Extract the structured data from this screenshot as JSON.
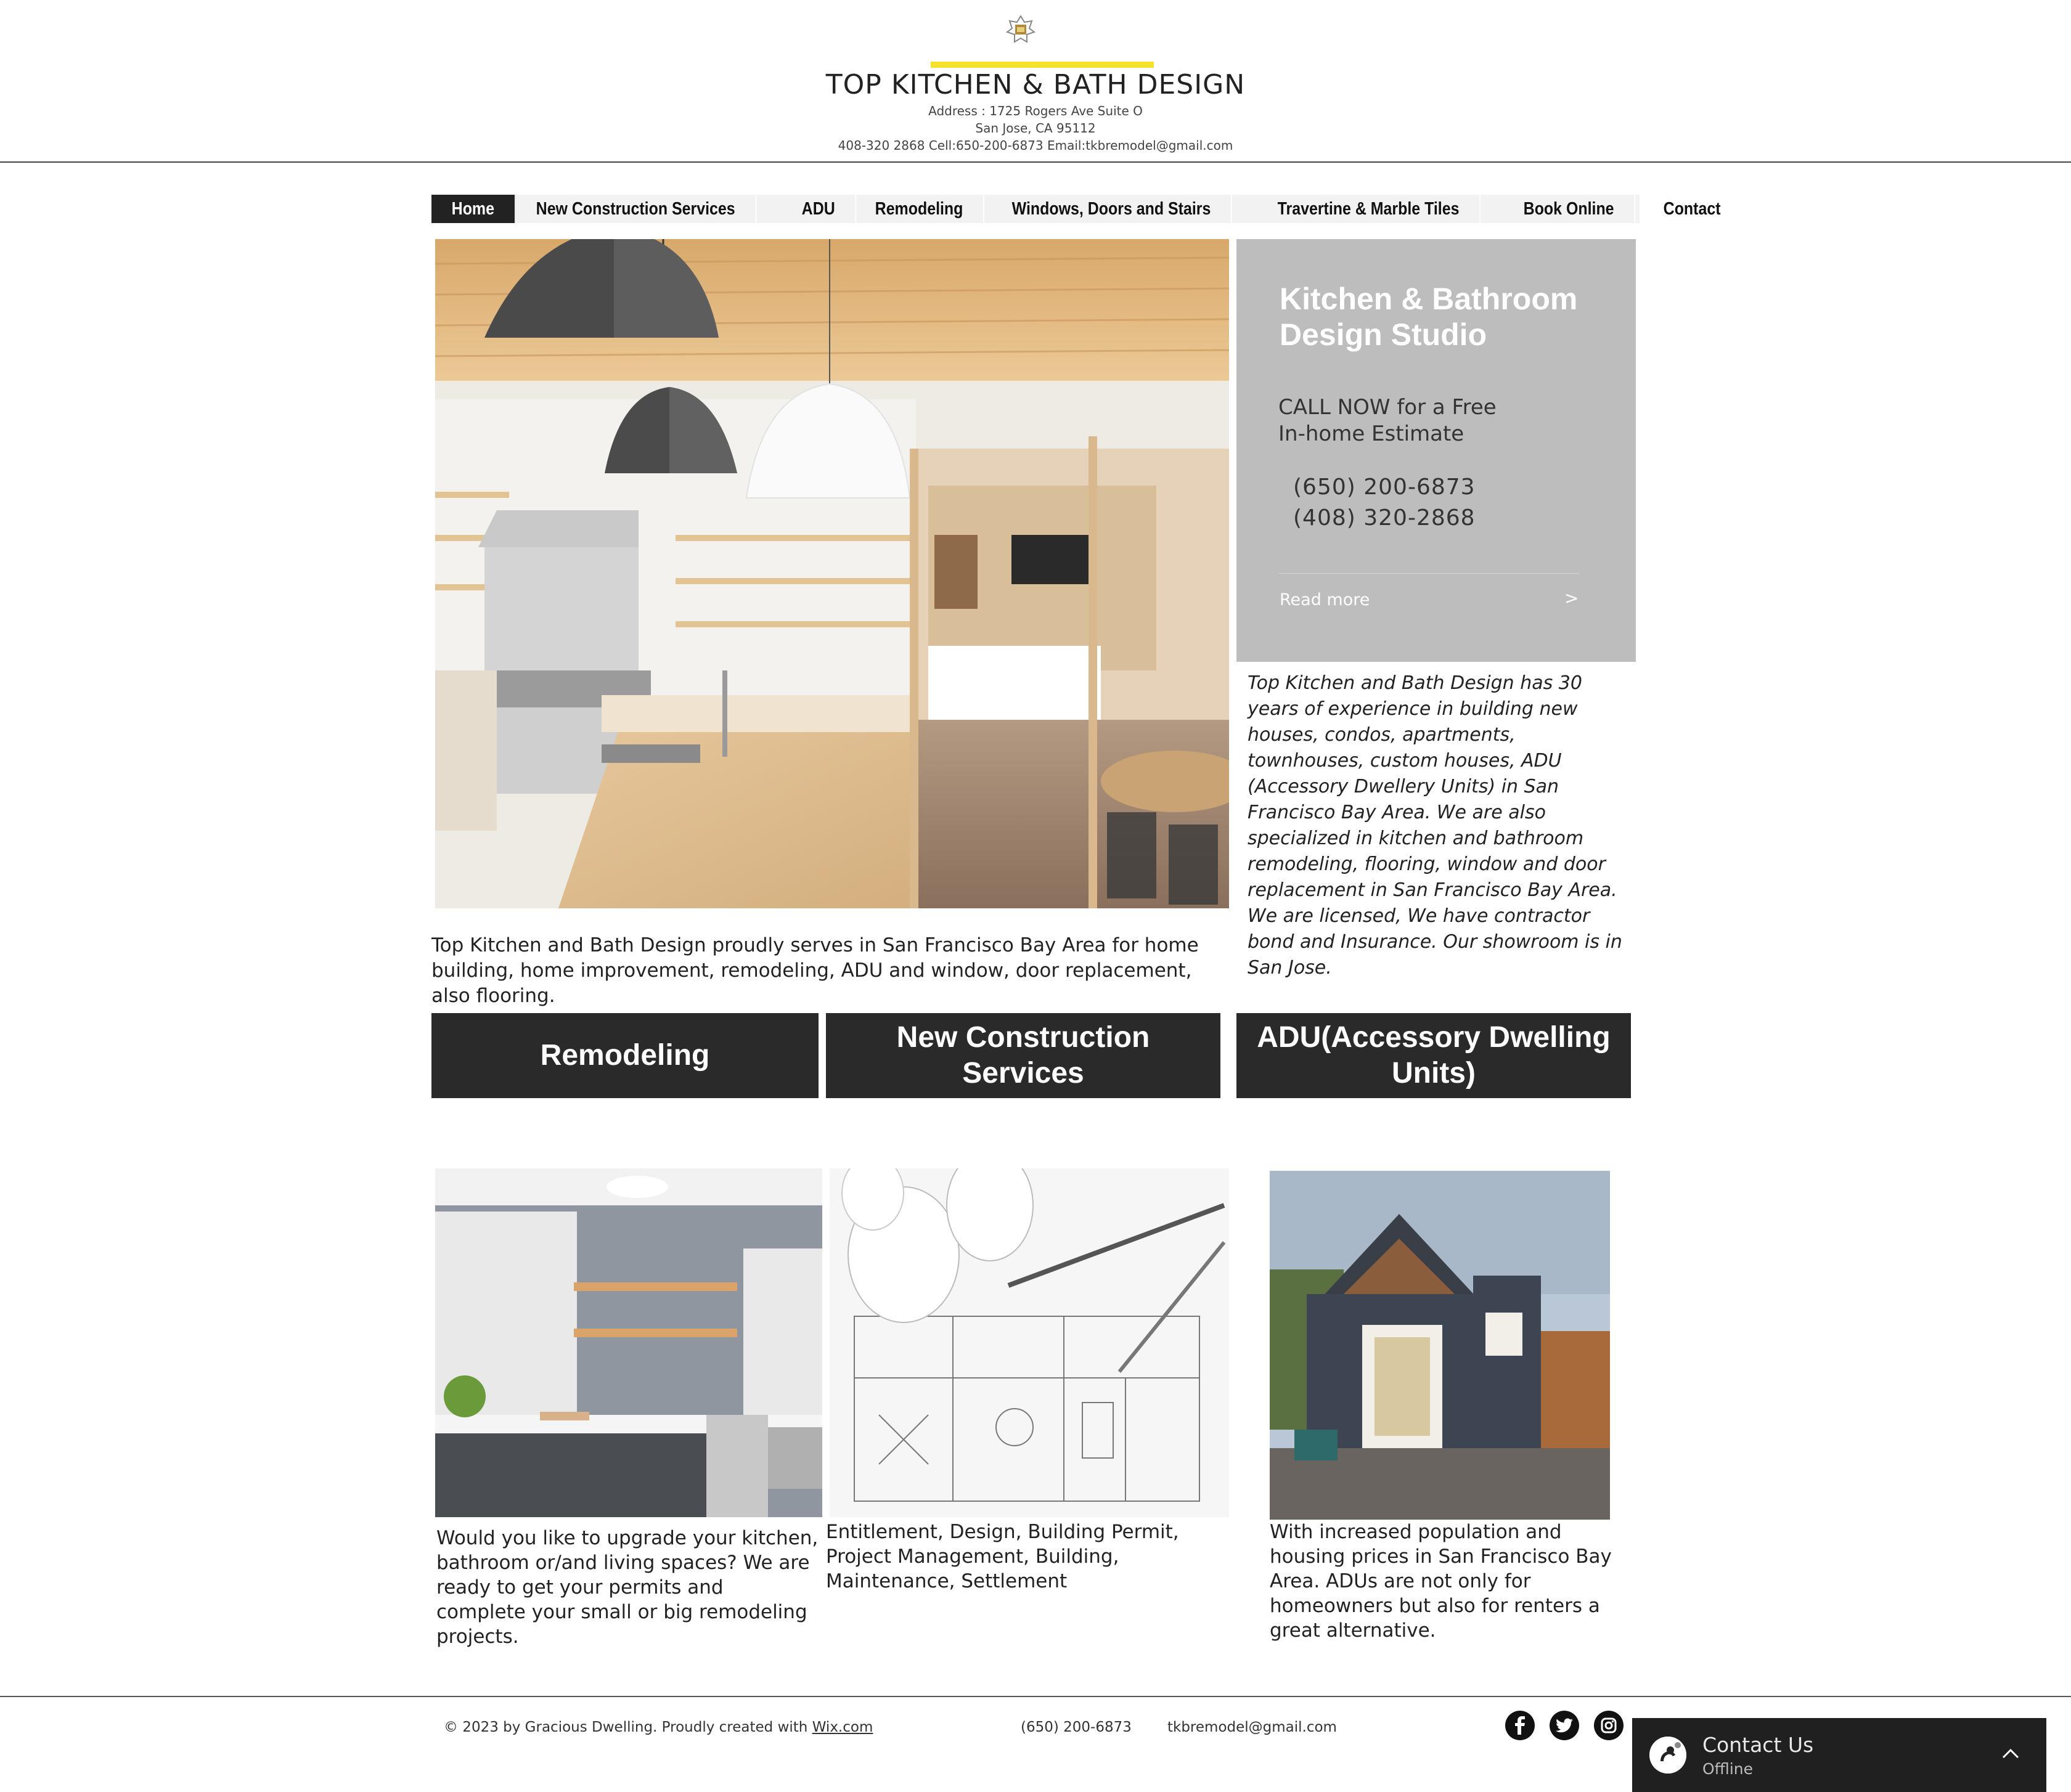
{
  "header": {
    "title": "TOP KITCHEN & BATH DESIGN",
    "address_line1": "Address : 1725 Rogers Ave Suite O",
    "address_line2": "San Jose, CA 95112",
    "contact_line": "408-320 2868 Cell:650-200-6873 Email:tkbremodel@gmail.com",
    "accent_color": "#f5e12a"
  },
  "nav": {
    "items": [
      {
        "label": "Home",
        "active": true
      },
      {
        "label": "New Construction Services"
      },
      {
        "label": "ADU"
      },
      {
        "label": "Remodeling"
      },
      {
        "label": "Windows, Doors and Stairs"
      },
      {
        "label": "Travertine & Marble Tiles"
      },
      {
        "label": "Book Online"
      },
      {
        "label": "Contact"
      }
    ]
  },
  "hero": {
    "box_title_line1": "Kitchen & Bathroom",
    "box_title_line2": "Design Studio",
    "cta_line1": "CALL NOW for a Free",
    "cta_line2": "In-home Estimate",
    "phone1": "(650)  200-6873",
    "phone2": "(408)  320-2868",
    "read_more": "Read more",
    "arrow": ">",
    "about": "Top Kitchen and Bath Design has 30 years of experience in building new houses, condos, apartments, townhouses, custom houses, ADU (Accessory Dwellery Units) in San Francisco Bay Area. We are also specialized in kitchen and bathroom remodeling, flooring, window and door replacement in San Francisco Bay Area. We are licensed, We have contractor bond and Insurance. Our showroom is in San Jose.",
    "serves": "Top Kitchen and Bath Design proudly serves in San Francisco Bay Area for home building, home improvement, remodeling, ADU and window, door replacement, also flooring."
  },
  "services": {
    "remodeling_label": "Remodeling",
    "construction_label": "New Construction Services",
    "adu_label": "ADU(Accessory Dwelling Units)",
    "remodeling_text": "Would you like to upgrade your kitchen, bathroom or/and living spaces? We are ready to get your permits and complete your small or big remodeling projects.",
    "construction_text": "Entitlement, Design, Building Permit, Project Management, Building, Maintenance, Settlement",
    "adu_text": "With increased population and housing prices in San Francisco Bay Area. ADUs are not only for homeowners but also for renters a great alternative."
  },
  "footer": {
    "copyright_prefix": "© 2023 by Gracious Dwelling. Proudly created with ",
    "copyright_link": "Wix.com",
    "phone": "(650) 200-6873",
    "email": "tkbremodel@gmail.com",
    "social_icons": [
      "facebook-icon",
      "twitter-icon",
      "instagram-icon"
    ]
  },
  "chat": {
    "title": "Contact Us",
    "status": "Offline"
  }
}
